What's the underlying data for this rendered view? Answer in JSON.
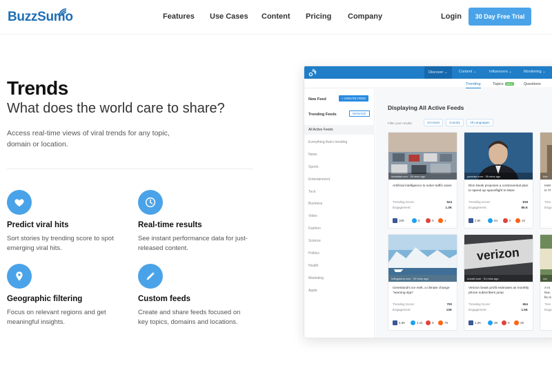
{
  "brand": {
    "name": "BuzzSum",
    "name_suffix": "o",
    "accent": "#4aa3e8",
    "primary": "#1f6fb5"
  },
  "nav": {
    "links": [
      "Features",
      "Use Cases",
      "Content",
      "Pricing",
      "Company"
    ],
    "login": "Login",
    "cta": "30 Day Free Trial"
  },
  "hero": {
    "title": "Trends",
    "subtitle": "What does the world care to share?",
    "description": "Access real-time views of viral trends for any topic, domain or location."
  },
  "features": [
    {
      "icon": "heart-icon",
      "title": "Predict viral hits",
      "desc": "Sort stories by trending score to spot emerging viral hits."
    },
    {
      "icon": "clock-icon",
      "title": "Real-time results",
      "desc": "See instant performance data for just-released content."
    },
    {
      "icon": "location-pin-icon",
      "title": "Geographic filtering",
      "desc": "Focus on relevant regions and get meaningful insights."
    },
    {
      "icon": "pencil-icon",
      "title": "Custom feeds",
      "desc": "Create and share feeds focused on key topics, domains and locations."
    }
  ],
  "mock": {
    "menu": [
      "Discover ⌄",
      "Content ⌄",
      "Influencers ⌄",
      "Monitoring ⌄"
    ],
    "tabs": {
      "trending": "Trending",
      "topics": "Topics",
      "topics_badge": "NEW",
      "questions": "Questions"
    },
    "sidebar": {
      "new_feed": "New Feed",
      "create_feed": "+ CREATE FEED",
      "trending_feeds": "Trending Feeds",
      "manage": "MANAGE",
      "items": [
        "All Active Feeds",
        "Everything that's trending",
        "News",
        "Sports",
        "Entertainment",
        "Tech",
        "Business",
        "Video",
        "Fashion",
        "Science",
        "Politics",
        "Health",
        "Marketing",
        "Apple"
      ]
    },
    "main": {
      "title": "Displaying All Active Feeds",
      "filter_label": "Filter your results:",
      "chips": [
        "24 Hours",
        "Country",
        "All Languages"
      ]
    },
    "cards": [
      {
        "source": "inhabitat.com · 39 mins ago",
        "headline": "Artificial intelligence to solve traffic woes",
        "score_label": "Trending Score:",
        "score": "524",
        "eng_label": "Engagement:",
        "engagement": "1.3K",
        "fb": "109",
        "tw": "5",
        "pin": "0",
        "rd": "1"
      },
      {
        "source": "youtube.com · 25 mins ago",
        "headline": "Elon Musk proposes a controversial plan to speed up spaceflight to Mars",
        "score_label": "Trending Score:",
        "score": "818",
        "eng_label": "Engagement:",
        "engagement": "86.K",
        "fb": "2.6k",
        "tw": "84",
        "pin": "0",
        "rd": "15"
      },
      {
        "source": "lvilingstone.com · 39 mins ago",
        "headline": "Greenland's ice melt, a climate change \"warning sign\"",
        "score_label": "Trending Score:",
        "score": "700",
        "eng_label": "Engagement:",
        "engagement": "13K",
        "fb": "6.3K",
        "tw": "4.1k",
        "pin": "0",
        "rd": "79"
      },
      {
        "source": "nuzzle.com · 31 mins ago",
        "headline": "Verizon beats profit estimates as monthly phone subscribers jump",
        "score_label": "Trending Score:",
        "score": "654",
        "eng_label": "Engagement:",
        "engagement": "1.5K",
        "fb": "1.2K",
        "tw": "38",
        "pin": "0",
        "rd": "28"
      }
    ],
    "peek_cards": [
      {
        "source": "Inte",
        "headline": "Instr in Tr",
        "score_label": "Tren",
        "eng_label": "Enga"
      },
      {
        "source": "cnc",
        "headline": "A m Nuc fis m",
        "score_label": "Tren",
        "eng_label": "Enga"
      }
    ],
    "card_images": [
      {
        "label": "verizon"
      }
    ]
  }
}
